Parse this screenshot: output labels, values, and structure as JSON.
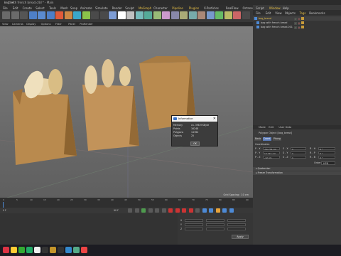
{
  "window": {
    "title": "bag with french bread.c4d * - Main",
    "controls": "—  ❐  ✕"
  },
  "menubar": {
    "items": [
      "File",
      "Edit",
      "Create",
      "Select",
      "Tools",
      "Mesh",
      "Snap",
      "Animate",
      "Simulate",
      "Render",
      "Sculpt",
      "MoGraph",
      "Character",
      "Pipeline",
      "Plugins",
      "X-Particles",
      "RealFlow",
      "Octane",
      "Script",
      "Window",
      "Help"
    ],
    "highlight": [
      "MoGraph",
      "Pipeline",
      "Plugins",
      "Window"
    ]
  },
  "viewmenu": {
    "items": [
      "View",
      "Cameras",
      "Display",
      "Options",
      "Filter",
      "Panel",
      "ProRender"
    ]
  },
  "viewport": {
    "grid_label": "Grid Spacing : 10 cm"
  },
  "info_dialog": {
    "title": "Information",
    "close": "✕",
    "rows": [
      {
        "label": "Memory",
        "value": "ca. 398.9 KByte"
      },
      {
        "label": "Points",
        "value": "16248"
      },
      {
        "label": "Polygons",
        "value": "14784"
      },
      {
        "label": "Objects",
        "value": "25"
      }
    ],
    "ok_label": "OK"
  },
  "right_menu": {
    "items": [
      "File",
      "Edit",
      "View",
      "Objects",
      "Tags",
      "Bookmarks"
    ]
  },
  "objects": [
    {
      "name": "bag_bread",
      "level": 0
    },
    {
      "name": "bag with french bread",
      "level": 1
    },
    {
      "name": "bag with french bread.001",
      "level": 1
    }
  ],
  "attributes": {
    "menu": [
      "Mode",
      "Edit",
      "User Data"
    ],
    "header": "Polygon Object [bag_bread]",
    "tabs": [
      "Basic",
      "Coord.",
      "Phong"
    ],
    "active_tab": "Coord.",
    "section_coordinates": "Coordinates",
    "order_label": "Order",
    "order_value": "HPB",
    "freeze_label": "▸ Quaternion",
    "freeze2_label": "▸ Freeze Transformation",
    "coords": [
      {
        "l": "P . X",
        "v": "-51.731 cm",
        "l2": "S . X",
        "v2": "1",
        "l3": "R . H",
        "v3": "0 °"
      },
      {
        "l": "P . Y",
        "v": "1.1721 cm",
        "l2": "S . Y",
        "v2": "1",
        "l3": "R . P",
        "v3": "0 °"
      },
      {
        "l": "P . Z",
        "v": "-12 cm",
        "l2": "S . Z",
        "v2": "1",
        "l3": "R . B",
        "v3": "0 °"
      }
    ]
  },
  "timeline": {
    "ticks": [
      "0",
      "5",
      "10",
      "15",
      "20",
      "25",
      "30",
      "35",
      "40",
      "45",
      "50",
      "55",
      "60",
      "65",
      "70",
      "75",
      "80",
      "85",
      "90"
    ],
    "frame": "0 F",
    "end": "90 F"
  },
  "coord_manager": {
    "apply_label": "Apply",
    "rows": [
      "X",
      "Y",
      "Z"
    ]
  },
  "colors": {
    "accent": "#e8c046",
    "select": "#4d8ad6",
    "record": "#c33"
  }
}
